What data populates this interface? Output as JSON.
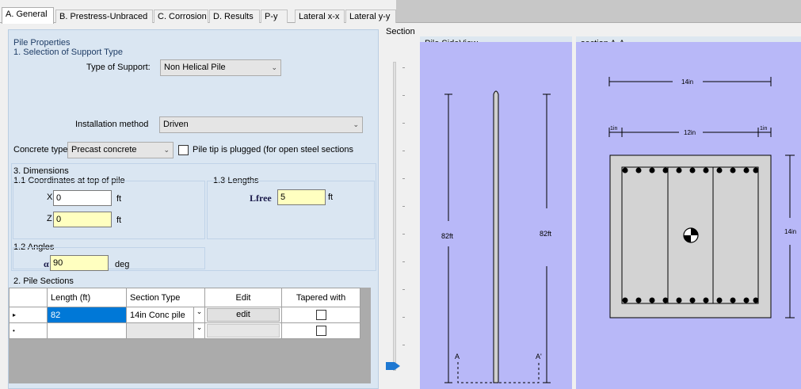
{
  "tabs": [
    "A. General",
    "B. Prestress-Unbraced",
    "C. Corrosion",
    "D. Results",
    "P-y",
    "Lateral x-x",
    "Lateral y-y"
  ],
  "pile_properties": {
    "title": "Pile Properties",
    "support_section_title": "1. Selection of Support Type",
    "type_of_support_label": "Type of Support:",
    "type_of_support_value": "Non Helical Pile",
    "installation_label": "Installation method",
    "installation_value": "Driven",
    "concrete_type_label": "Concrete type",
    "concrete_type_value": "Precast concrete",
    "pile_tip_label": "Pile tip is plugged (for open steel sections"
  },
  "dimensions": {
    "title": "3. Dimensions",
    "coords_title": "1.1 Coordinates at top of pile",
    "x_label": "X",
    "x_value": "0",
    "x_unit": "ft",
    "z_label": "Z",
    "z_value": "0",
    "z_unit": "ft",
    "lengths_title": "1.3 Lengths",
    "lfree_label": "Lfree",
    "lfree_value": "5",
    "lfree_unit": "ft",
    "angles_title": "1.2 Angles",
    "alpha_label": "α",
    "alpha_value": "90",
    "alpha_unit": "deg"
  },
  "pile_sections": {
    "title": "2. Pile Sections",
    "columns": [
      "",
      "Length (ft)",
      "Section Type",
      "Edit",
      "Tapered with"
    ],
    "rows": [
      {
        "marker": "▸",
        "length": "82",
        "section_type": "14in Conc pile",
        "edit": "edit"
      },
      {
        "marker": "•",
        "length": "",
        "section_type": "",
        "edit": ""
      }
    ]
  },
  "section_label": "Section",
  "side_view": {
    "title": "Pile SideView",
    "left_dim": "82ft",
    "right_dim": "82ft",
    "label_a": "A",
    "label_a_prime": "A'"
  },
  "section_aa": {
    "title": "section A-A",
    "top_dim": "14in",
    "cover_left": "1in",
    "inner_dim": "12in",
    "cover_right": "1in",
    "right_dim": "14in"
  },
  "colors": {
    "panel_bg": "#dae6f2",
    "drawing_bg": "#b8b8f8",
    "input_highlight": "#ffffc0",
    "selection": "#0078d7"
  }
}
